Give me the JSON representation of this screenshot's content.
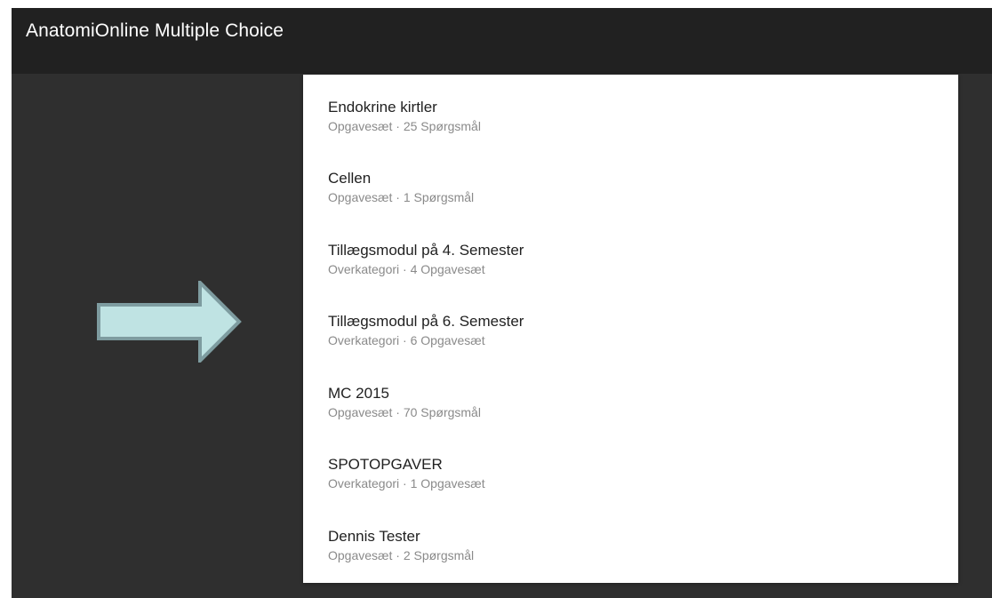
{
  "app": {
    "title": "AnatomiOnline Multiple Choice"
  },
  "annotation": {
    "icon": "right-arrow-icon",
    "fill_color": "#bfe3e3",
    "stroke_color": "#7e9ca0"
  },
  "colors": {
    "appbar": "#212121",
    "background": "#2f2f2f",
    "card": "#ffffff"
  },
  "list": {
    "items": [
      {
        "title": "Endokrine kirtler",
        "type": "Opgavesæt",
        "count": "25 Spørgsmål",
        "subtitle": "Opgavesæt · 25 Spørgsmål"
      },
      {
        "title": "Cellen",
        "type": "Opgavesæt",
        "count": "1 Spørgsmål",
        "subtitle": "Opgavesæt · 1 Spørgsmål"
      },
      {
        "title": "Tillægsmodul på 4. Semester",
        "type": "Overkategori",
        "count": "4 Opgavesæt",
        "subtitle": "Overkategori · 4 Opgavesæt"
      },
      {
        "title": "Tillægsmodul på 6. Semester",
        "type": "Overkategori",
        "count": "6 Opgavesæt",
        "subtitle": "Overkategori · 6 Opgavesæt"
      },
      {
        "title": "MC 2015",
        "type": "Opgavesæt",
        "count": "70 Spørgsmål",
        "subtitle": "Opgavesæt · 70 Spørgsmål"
      },
      {
        "title": "SPOTOPGAVER",
        "type": "Overkategori",
        "count": "1 Opgavesæt",
        "subtitle": "Overkategori · 1 Opgavesæt"
      },
      {
        "title": "Dennis Tester",
        "type": "Opgavesæt",
        "count": "2 Spørgsmål",
        "subtitle": "Opgavesæt · 2 Spørgsmål"
      }
    ]
  }
}
